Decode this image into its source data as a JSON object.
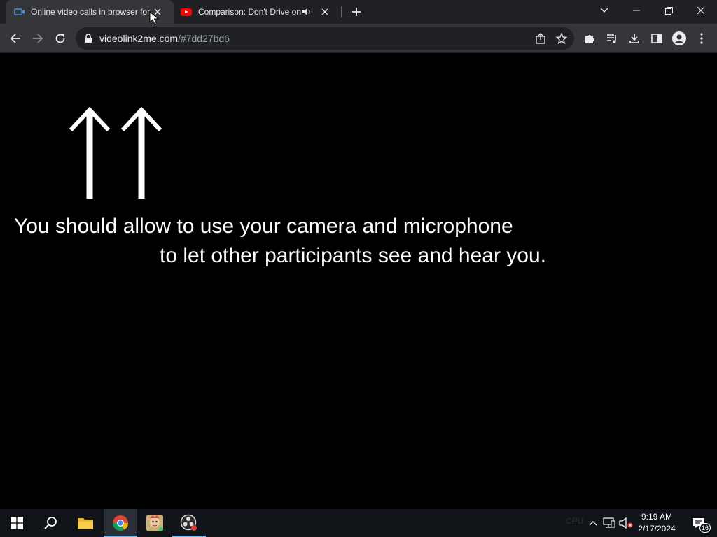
{
  "browser": {
    "tabs": [
      {
        "title": "Online video calls in browser for",
        "favicon": "video-call-icon",
        "active": true
      },
      {
        "title": "Comparison: Don't Drive on",
        "favicon": "youtube-icon",
        "audio": "speaker-icon",
        "active": false
      }
    ],
    "address": {
      "host": "videolink2me.com",
      "path": "/#7dd27bd6"
    }
  },
  "page": {
    "message_line1": "You should allow to use your camera and microphone",
    "message_line2": "to let other participants see and hear you."
  },
  "taskbar": {
    "ghost_labels": [
      "CPU"
    ],
    "clock_time": "9:19 AM",
    "clock_date": "2/17/2024",
    "notification_count": "16"
  },
  "colors": {
    "tab_bar": "#202124",
    "toolbar": "#35363a",
    "page_bg": "#000000",
    "taskbar": "#101418",
    "accent": "#76b9ed"
  }
}
